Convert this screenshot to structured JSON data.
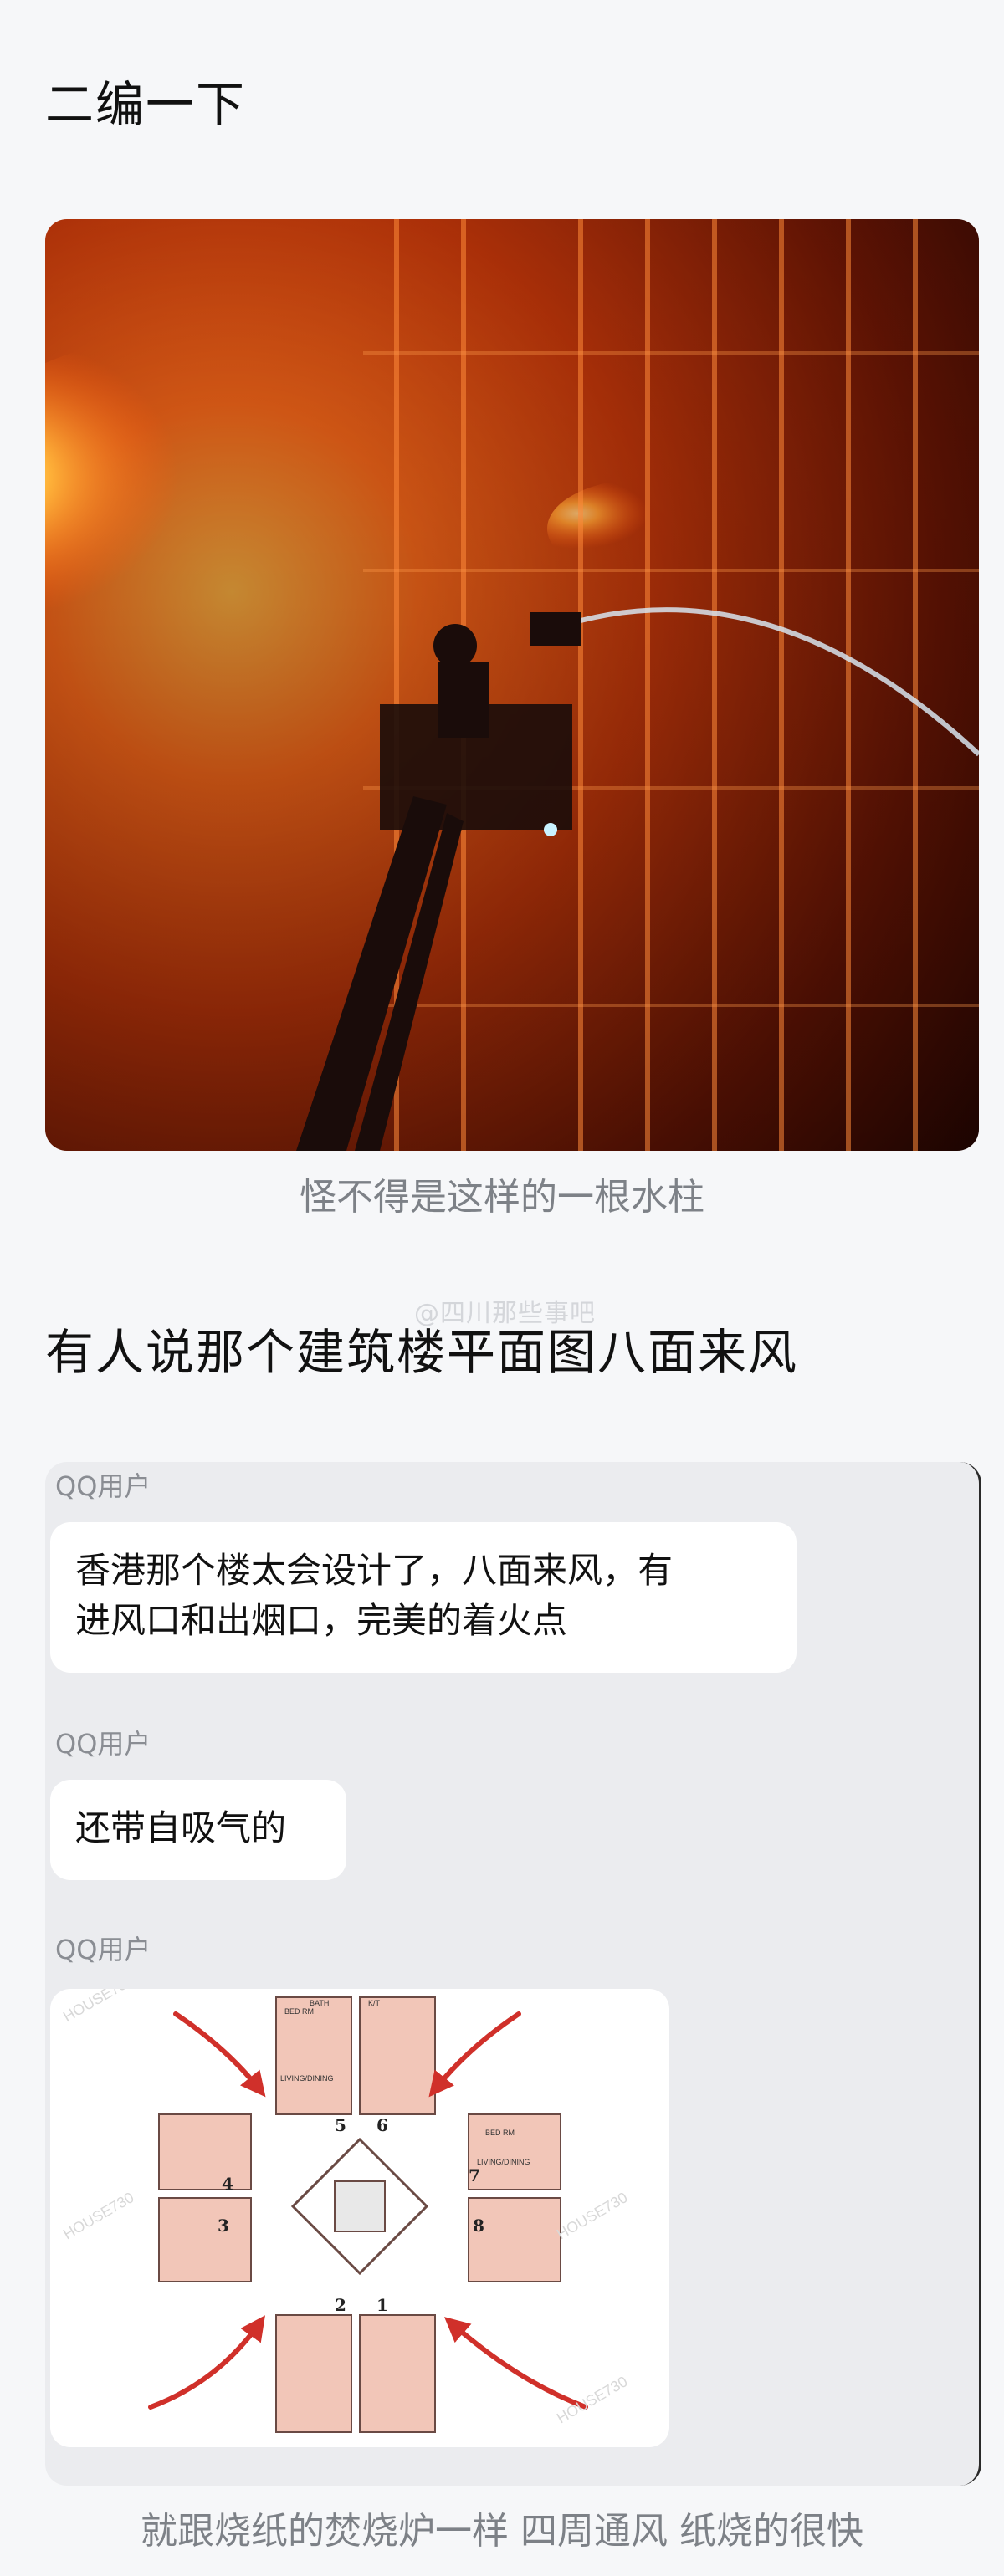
{
  "heading1": "二编一下",
  "photo_caption": "怪不得是这样的一根水柱",
  "heading2": "有人说那个建筑楼平面图八面来风",
  "watermark": "@四川那些事吧",
  "chat": {
    "messages": [
      {
        "sender": "QQ用户",
        "text_line1": "香港那个楼太会设计了，八面来风，有",
        "text_line2": "进风口和出烟口，完美的着火点"
      },
      {
        "sender": "QQ用户",
        "text": "还带自吸气的"
      },
      {
        "sender": "QQ用户"
      }
    ]
  },
  "floorplan": {
    "unit_numbers": [
      "1",
      "2",
      "3",
      "4",
      "5",
      "6",
      "7",
      "8"
    ],
    "room_labels": [
      "BED RM",
      "BED RM",
      "LIVING/DINING",
      "LIVING/DINING",
      "BATH",
      "K/T"
    ],
    "watermark_text": "HOUSE730"
  },
  "bottom_caption": "就跟烧纸的焚烧炉一样 四周通风 纸烧的很快",
  "colors": {
    "fire_bright": "#ffb040",
    "fire_deep": "#c9380a",
    "arrow_red": "#d0302a",
    "plan_pink": "#f2c6b8"
  }
}
